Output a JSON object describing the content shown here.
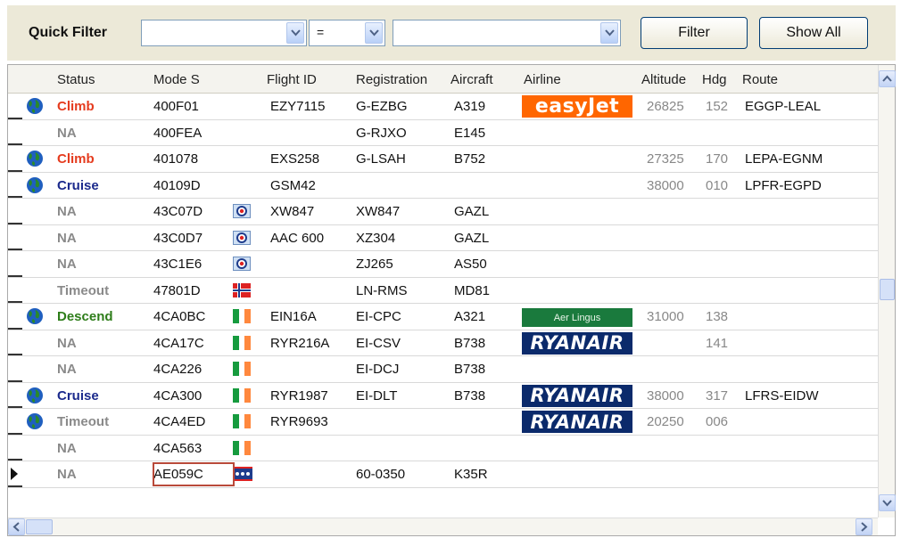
{
  "toolbar": {
    "label": "Quick Filter",
    "field_value": "",
    "operator_value": "=",
    "filter_value": "",
    "filter_button": "Filter",
    "show_all_button": "Show All"
  },
  "columns": [
    "Status",
    "Mode S",
    "Flight ID",
    "Registration",
    "Aircraft",
    "Airline",
    "Altitude",
    "Hdg",
    "Route"
  ],
  "colors": {
    "climb": "#e53b1e",
    "cruise": "#1b2a8c",
    "descend": "#2e7d1a",
    "na": "#8a8a8a",
    "timeout": "#8a8a8a",
    "easyjet": "#ff6600",
    "ryanair": "#0b2a6b",
    "aerlingus": "#1a7a3d",
    "selection": "#b94a3a"
  },
  "rows": [
    {
      "status": "Climb",
      "state": "climb",
      "globe": true,
      "mode_s": "400F01",
      "flag": "",
      "flight_id": "EZY7115",
      "registration": "G-EZBG",
      "aircraft": "A319",
      "airline": "easyjet",
      "airline_text": "easyJet",
      "altitude": "26825",
      "hdg": "152",
      "route": "EGGP-LEAL"
    },
    {
      "status": "NA",
      "state": "na",
      "globe": false,
      "mode_s": "400FEA",
      "flag": "",
      "flight_id": "",
      "registration": "G-RJXO",
      "aircraft": "E145",
      "airline": "",
      "airline_text": "",
      "altitude": "",
      "hdg": "",
      "route": ""
    },
    {
      "status": "Climb",
      "state": "climb",
      "globe": true,
      "mode_s": "401078",
      "flag": "",
      "flight_id": "EXS258",
      "registration": "G-LSAH",
      "aircraft": "B752",
      "airline": "",
      "airline_text": "",
      "altitude": "27325",
      "hdg": "170",
      "route": "LEPA-EGNM"
    },
    {
      "status": "Cruise",
      "state": "cruise",
      "globe": true,
      "mode_s": "40109D",
      "flag": "",
      "flight_id": "GSM42",
      "registration": "",
      "aircraft": "",
      "airline": "",
      "airline_text": "",
      "altitude": "38000",
      "hdg": "010",
      "route": "LPFR-EGPD"
    },
    {
      "status": "NA",
      "state": "na",
      "globe": false,
      "mode_s": "43C07D",
      "flag": "uk-roundel",
      "flight_id": "XW847",
      "registration": "XW847",
      "aircraft": "GAZL",
      "airline": "",
      "airline_text": "",
      "altitude": "",
      "hdg": "",
      "route": ""
    },
    {
      "status": "NA",
      "state": "na",
      "globe": false,
      "mode_s": "43C0D7",
      "flag": "uk-roundel",
      "flight_id": "AAC 600",
      "registration": "XZ304",
      "aircraft": "GAZL",
      "airline": "",
      "airline_text": "",
      "altitude": "",
      "hdg": "",
      "route": ""
    },
    {
      "status": "NA",
      "state": "na",
      "globe": false,
      "mode_s": "43C1E6",
      "flag": "uk-roundel",
      "flight_id": "",
      "registration": "ZJ265",
      "aircraft": "AS50",
      "airline": "",
      "airline_text": "",
      "altitude": "",
      "hdg": "",
      "route": ""
    },
    {
      "status": "Timeout",
      "state": "timeout",
      "globe": false,
      "mode_s": "47801D",
      "flag": "norway",
      "flight_id": "",
      "registration": "LN-RMS",
      "aircraft": "MD81",
      "airline": "",
      "airline_text": "",
      "altitude": "",
      "hdg": "",
      "route": ""
    },
    {
      "status": "Descend",
      "state": "descend",
      "globe": true,
      "mode_s": "4CA0BC",
      "flag": "ireland",
      "flight_id": "EIN16A",
      "registration": "EI-CPC",
      "aircraft": "A321",
      "airline": "aerlingus",
      "airline_text": "Aer Lingus",
      "altitude": "31000",
      "hdg": "138",
      "route": ""
    },
    {
      "status": "NA",
      "state": "na",
      "globe": false,
      "mode_s": "4CA17C",
      "flag": "ireland",
      "flight_id": "RYR216A",
      "registration": "EI-CSV",
      "aircraft": "B738",
      "airline": "ryanair",
      "airline_text": "RYANAIR",
      "altitude": "",
      "hdg": "141",
      "route": ""
    },
    {
      "status": "NA",
      "state": "na",
      "globe": false,
      "mode_s": "4CA226",
      "flag": "ireland",
      "flight_id": "",
      "registration": "EI-DCJ",
      "aircraft": "B738",
      "airline": "",
      "airline_text": "",
      "altitude": "",
      "hdg": "",
      "route": ""
    },
    {
      "status": "Cruise",
      "state": "cruise",
      "globe": true,
      "mode_s": "4CA300",
      "flag": "ireland",
      "flight_id": "RYR1987",
      "registration": "EI-DLT",
      "aircraft": "B738",
      "airline": "ryanair",
      "airline_text": "RYANAIR",
      "altitude": "38000",
      "hdg": "317",
      "route": "LFRS-EIDW"
    },
    {
      "status": "Timeout",
      "state": "timeout",
      "globe": true,
      "mode_s": "4CA4ED",
      "flag": "ireland",
      "flight_id": "RYR9693",
      "registration": "",
      "aircraft": "",
      "airline": "ryanair",
      "airline_text": "RYANAIR",
      "altitude": "20250",
      "hdg": "006",
      "route": ""
    },
    {
      "status": "NA",
      "state": "na",
      "globe": false,
      "mode_s": "4CA563",
      "flag": "ireland",
      "flight_id": "",
      "registration": "",
      "aircraft": "",
      "airline": "",
      "airline_text": "",
      "altitude": "",
      "hdg": "",
      "route": ""
    },
    {
      "status": "NA",
      "state": "na",
      "globe": false,
      "mode_s": "AE059C",
      "flag": "usa",
      "flight_id": "",
      "registration": "60-0350",
      "aircraft": "K35R",
      "airline": "",
      "airline_text": "",
      "altitude": "",
      "hdg": "",
      "route": "",
      "current": true
    }
  ]
}
